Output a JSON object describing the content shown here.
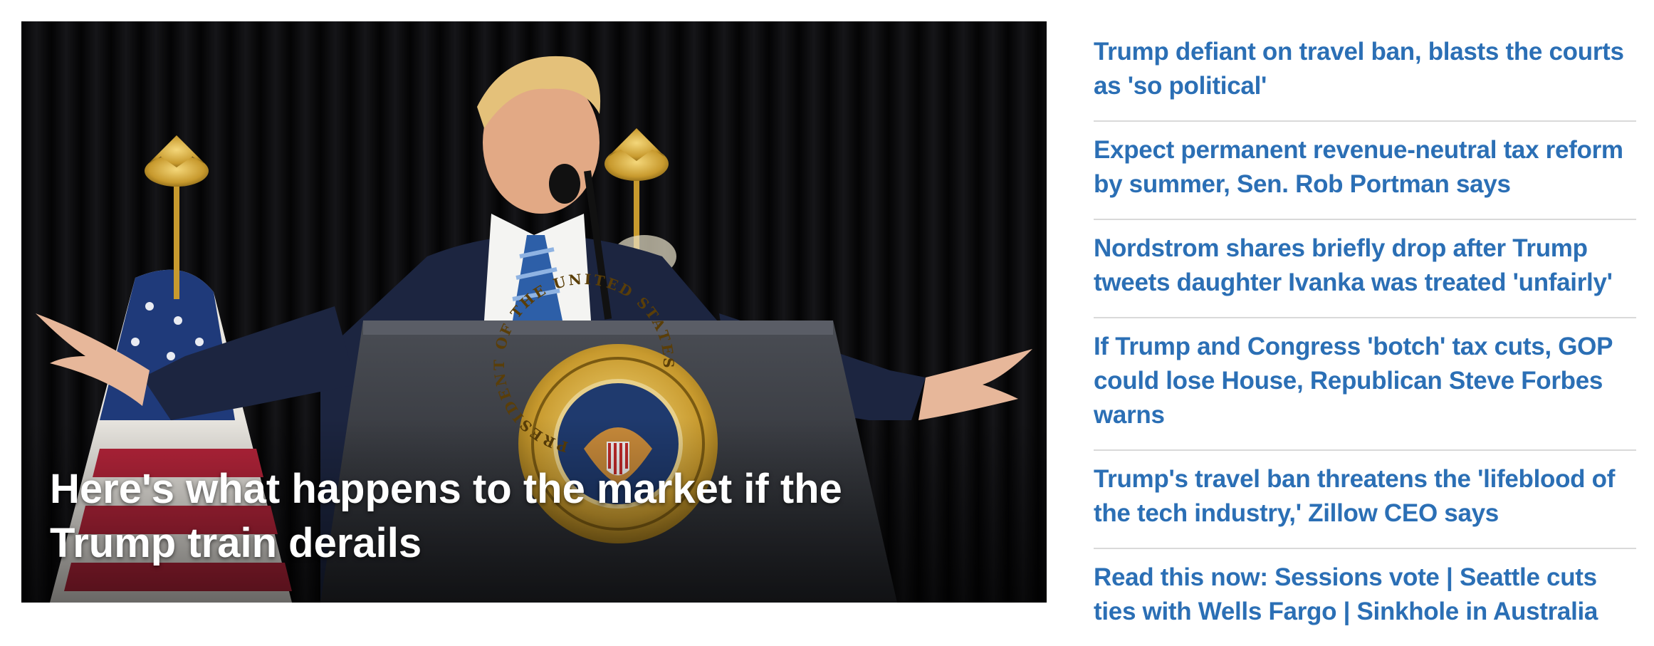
{
  "hero": {
    "headline": "Here's what happens to the market if the Trump train derails",
    "image_alt": "Trump at podium with arms outstretched",
    "seal_text": "PRESIDENT OF THE UNITED STATES"
  },
  "headlines": [
    {
      "text": "Trump defiant on travel ban, blasts the courts as 'so political'"
    },
    {
      "text": "Expect permanent revenue-neutral tax reform by summer, Sen. Rob Portman says"
    },
    {
      "text": "Nordstrom shares briefly drop after Trump tweets daughter Ivanka was treated 'unfairly'"
    },
    {
      "text": "If Trump and Congress 'botch' tax cuts, GOP could lose House, Republican Steve Forbes warns"
    },
    {
      "text": "Trump's travel ban threatens the 'lifeblood of the tech industry,' Zillow CEO says"
    },
    {
      "text": "Read this now: Sessions vote | Seattle cuts ties with Wells Fargo | Sinkhole in Australia"
    }
  ],
  "colors": {
    "link": "#2b6fb5",
    "divider": "#d9d9d9",
    "hero_bg": "#0c0c0e"
  }
}
